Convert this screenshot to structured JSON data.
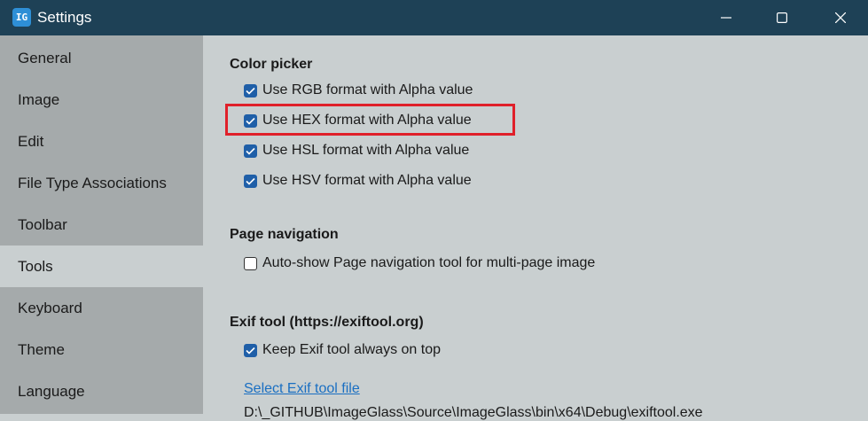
{
  "window": {
    "title": "Settings",
    "app_icon_glyph": "IG"
  },
  "sidebar": {
    "items": [
      {
        "label": "General"
      },
      {
        "label": "Image"
      },
      {
        "label": "Edit"
      },
      {
        "label": "File Type Associations"
      },
      {
        "label": "Toolbar"
      },
      {
        "label": "Tools",
        "active": true
      },
      {
        "label": "Keyboard"
      },
      {
        "label": "Theme"
      },
      {
        "label": "Language"
      }
    ]
  },
  "color_picker": {
    "title": "Color picker",
    "options": [
      {
        "label": "Use RGB format with Alpha value",
        "checked": true
      },
      {
        "label": "Use HEX format with Alpha value",
        "checked": true,
        "highlighted": true
      },
      {
        "label": "Use HSL format with Alpha value",
        "checked": true
      },
      {
        "label": "Use HSV format with Alpha value",
        "checked": true
      }
    ]
  },
  "page_navigation": {
    "title": "Page navigation",
    "option": {
      "label": "Auto-show Page navigation tool for multi-page image",
      "checked": false
    }
  },
  "exif_tool": {
    "title": "Exif tool (https://exiftool.org)",
    "option": {
      "label": "Keep Exif tool always on top",
      "checked": true
    },
    "select_link": "Select Exif tool file",
    "path": "D:\\_GITHUB\\ImageGlass\\Source\\ImageGlass\\bin\\x64\\Debug\\exiftool.exe"
  },
  "colors": {
    "titlebar": "#1e4156",
    "sidebar": "#a5aaab",
    "content": "#c9cfd0",
    "checkbox_accent": "#1f5fa8",
    "highlight": "#e0202a",
    "link": "#1a6fc2"
  }
}
